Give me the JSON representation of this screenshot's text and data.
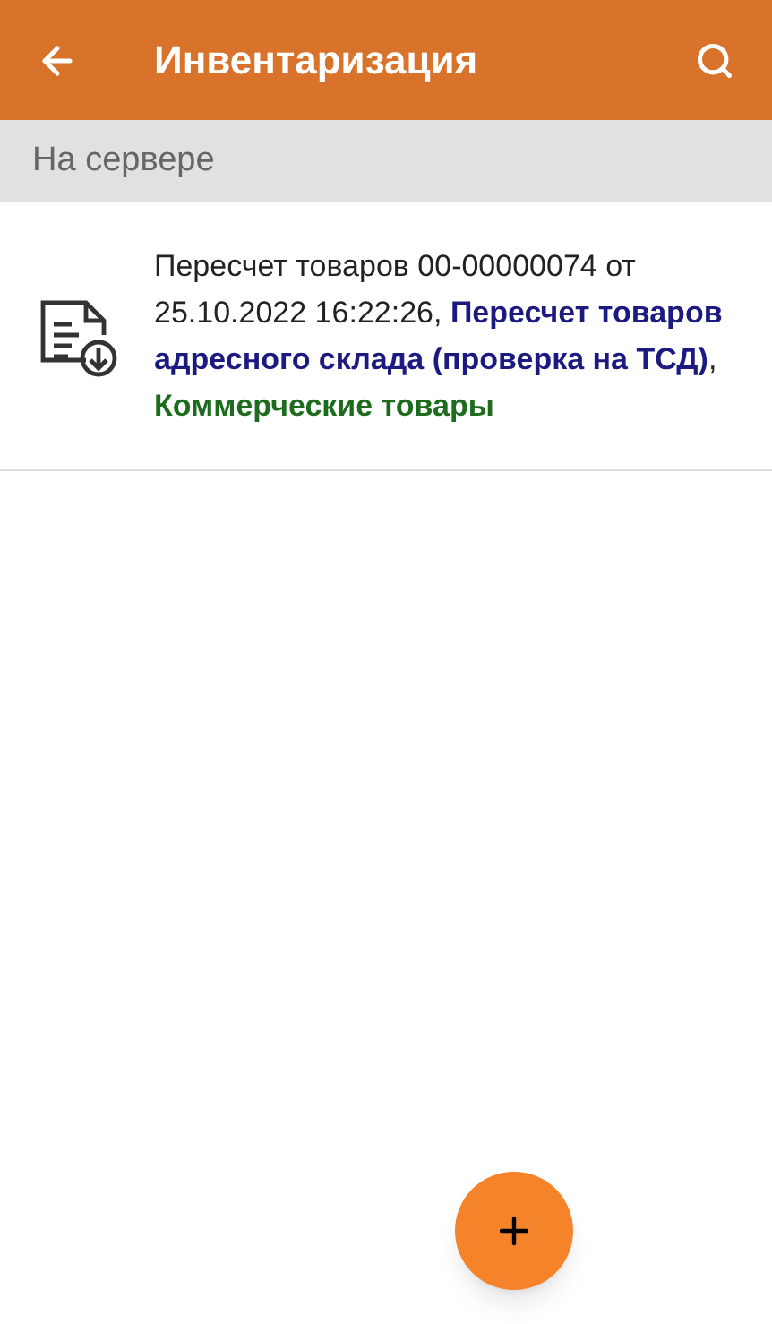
{
  "app_bar": {
    "title": "Инвентаризация"
  },
  "section": {
    "title": "На сервере"
  },
  "documents": [
    {
      "segments": [
        {
          "kind": "plain",
          "text": "Пересчет товаров 00-00000074 от 25.10.2022 16:22:26, "
        },
        {
          "kind": "operation",
          "text": "Пересчет товаров адресного склада (проверка на ТСД)"
        },
        {
          "kind": "plain",
          "text": ", "
        },
        {
          "kind": "category",
          "text": "Коммерческие товары"
        }
      ]
    }
  ]
}
